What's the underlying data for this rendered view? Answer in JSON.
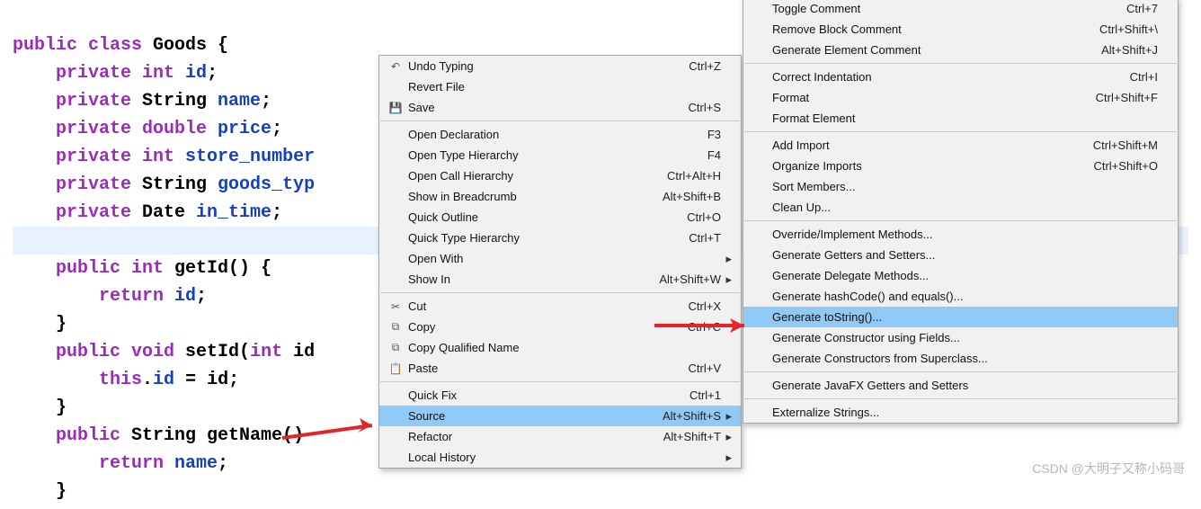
{
  "code": {
    "l1a": "public",
    "l1b": " class",
    "l1c": " Goods {",
    "l2a": "    private",
    "l2b": " int",
    "l2c": " id",
    "l2d": ";",
    "l3a": "    private",
    "l3b": " String ",
    "l3c": "name",
    "l3d": ";",
    "l4a": "    private",
    "l4b": " double",
    "l4c": " price",
    "l4d": ";",
    "l5a": "    private",
    "l5b": " int",
    "l5c": " store_number",
    "l6a": "    private",
    "l6b": " String ",
    "l6c": "goods_typ",
    "l7a": "    private",
    "l7b": " Date ",
    "l7c": "in_time",
    "l7d": ";",
    "l8": "    ",
    "l9a": "    public",
    "l9b": " int",
    "l9c": " getId() {",
    "l10a": "        return",
    "l10b": " id",
    "l10c": ";",
    "l11": "    }",
    "l12a": "    public",
    "l12b": " void",
    "l12c": " setId(",
    "l12d": "int",
    "l12e": " id",
    "l13a": "        this",
    "l13b": ".",
    "l13c": "id",
    "l13d": " = id;",
    "l14": "    }",
    "l15a": "    public",
    "l15b": " String getName()",
    "l16a": "        return",
    "l16b": " name",
    "l16c": ";",
    "l17": "    }"
  },
  "menu1": {
    "items": [
      {
        "label": "Undo Typing",
        "shortcut": "Ctrl+Z",
        "icon": "↶"
      },
      {
        "label": "Revert File",
        "shortcut": ""
      },
      {
        "label": "Save",
        "shortcut": "Ctrl+S",
        "icon": "💾"
      },
      {
        "sep": true
      },
      {
        "label": "Open Declaration",
        "shortcut": "F3"
      },
      {
        "label": "Open Type Hierarchy",
        "shortcut": "F4"
      },
      {
        "label": "Open Call Hierarchy",
        "shortcut": "Ctrl+Alt+H"
      },
      {
        "label": "Show in Breadcrumb",
        "shortcut": "Alt+Shift+B"
      },
      {
        "label": "Quick Outline",
        "shortcut": "Ctrl+O"
      },
      {
        "label": "Quick Type Hierarchy",
        "shortcut": "Ctrl+T"
      },
      {
        "label": "Open With",
        "shortcut": "",
        "submenu": true
      },
      {
        "label": "Show In",
        "shortcut": "Alt+Shift+W",
        "submenu": true
      },
      {
        "sep": true
      },
      {
        "label": "Cut",
        "shortcut": "Ctrl+X",
        "icon": "✂"
      },
      {
        "label": "Copy",
        "shortcut": "Ctrl+C",
        "icon": "⧉"
      },
      {
        "label": "Copy Qualified Name",
        "shortcut": "",
        "icon": "⧉"
      },
      {
        "label": "Paste",
        "shortcut": "Ctrl+V",
        "icon": "📋"
      },
      {
        "sep": true
      },
      {
        "label": "Quick Fix",
        "shortcut": "Ctrl+1"
      },
      {
        "label": "Source",
        "shortcut": "Alt+Shift+S",
        "submenu": true,
        "selected": true
      },
      {
        "label": "Refactor",
        "shortcut": "Alt+Shift+T",
        "submenu": true
      },
      {
        "label": "Local History",
        "shortcut": "",
        "submenu": true
      }
    ]
  },
  "menu2": {
    "items": [
      {
        "label": "Toggle Comment",
        "shortcut": "Ctrl+7"
      },
      {
        "label": "Remove Block Comment",
        "shortcut": "Ctrl+Shift+\\"
      },
      {
        "label": "Generate Element Comment",
        "shortcut": "Alt+Shift+J"
      },
      {
        "sep": true
      },
      {
        "label": "Correct Indentation",
        "shortcut": "Ctrl+I"
      },
      {
        "label": "Format",
        "shortcut": "Ctrl+Shift+F"
      },
      {
        "label": "Format Element",
        "shortcut": ""
      },
      {
        "sep": true
      },
      {
        "label": "Add Import",
        "shortcut": "Ctrl+Shift+M"
      },
      {
        "label": "Organize Imports",
        "shortcut": "Ctrl+Shift+O"
      },
      {
        "label": "Sort Members...",
        "shortcut": ""
      },
      {
        "label": "Clean Up...",
        "shortcut": ""
      },
      {
        "sep": true
      },
      {
        "label": "Override/Implement Methods...",
        "shortcut": ""
      },
      {
        "label": "Generate Getters and Setters...",
        "shortcut": ""
      },
      {
        "label": "Generate Delegate Methods...",
        "shortcut": ""
      },
      {
        "label": "Generate hashCode() and equals()...",
        "shortcut": ""
      },
      {
        "label": "Generate toString()...",
        "shortcut": "",
        "selected": true
      },
      {
        "label": "Generate Constructor using Fields...",
        "shortcut": ""
      },
      {
        "label": "Generate Constructors from Superclass...",
        "shortcut": ""
      },
      {
        "sep": true
      },
      {
        "label": "Generate JavaFX Getters and Setters",
        "shortcut": ""
      },
      {
        "sep": true
      },
      {
        "label": "Externalize Strings...",
        "shortcut": ""
      }
    ]
  },
  "watermark": "CSDN @大明子又称小码哥"
}
